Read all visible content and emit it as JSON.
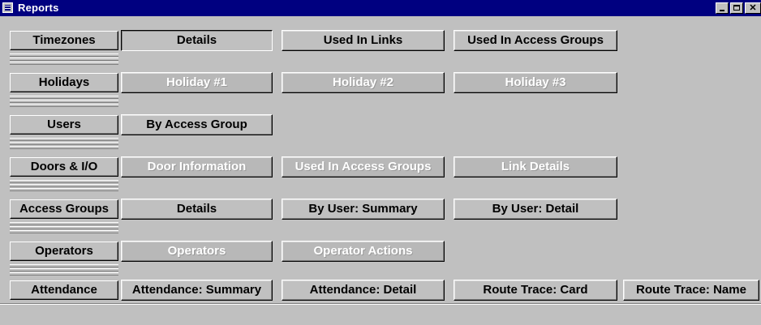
{
  "window": {
    "title": "Reports"
  },
  "rows": [
    {
      "label": "Timezones",
      "buttons": [
        "Details",
        "Used In Links",
        "Used In Access Groups"
      ]
    },
    {
      "label": "Holidays",
      "buttons": [
        "Holiday #1",
        "Holiday #2",
        "Holiday #3"
      ]
    },
    {
      "label": "Users",
      "buttons": [
        "By Access Group"
      ]
    },
    {
      "label": "Doors & I/O",
      "buttons": [
        "Door Information",
        "Used In Access Groups",
        "Link Details"
      ]
    },
    {
      "label": "Access Groups",
      "buttons": [
        "Details",
        "By User: Summary",
        "By User: Detail"
      ]
    },
    {
      "label": "Operators",
      "buttons": [
        "Operators",
        "Operator Actions"
      ]
    },
    {
      "label": "Attendance",
      "buttons": [
        "Attendance: Summary",
        "Attendance: Detail",
        "Route Trace: Card",
        "Route Trace: Name"
      ]
    }
  ],
  "colors": {
    "face": "#c0c0c0",
    "titlebar": "#000080",
    "disabled_text": "#ffffff"
  }
}
